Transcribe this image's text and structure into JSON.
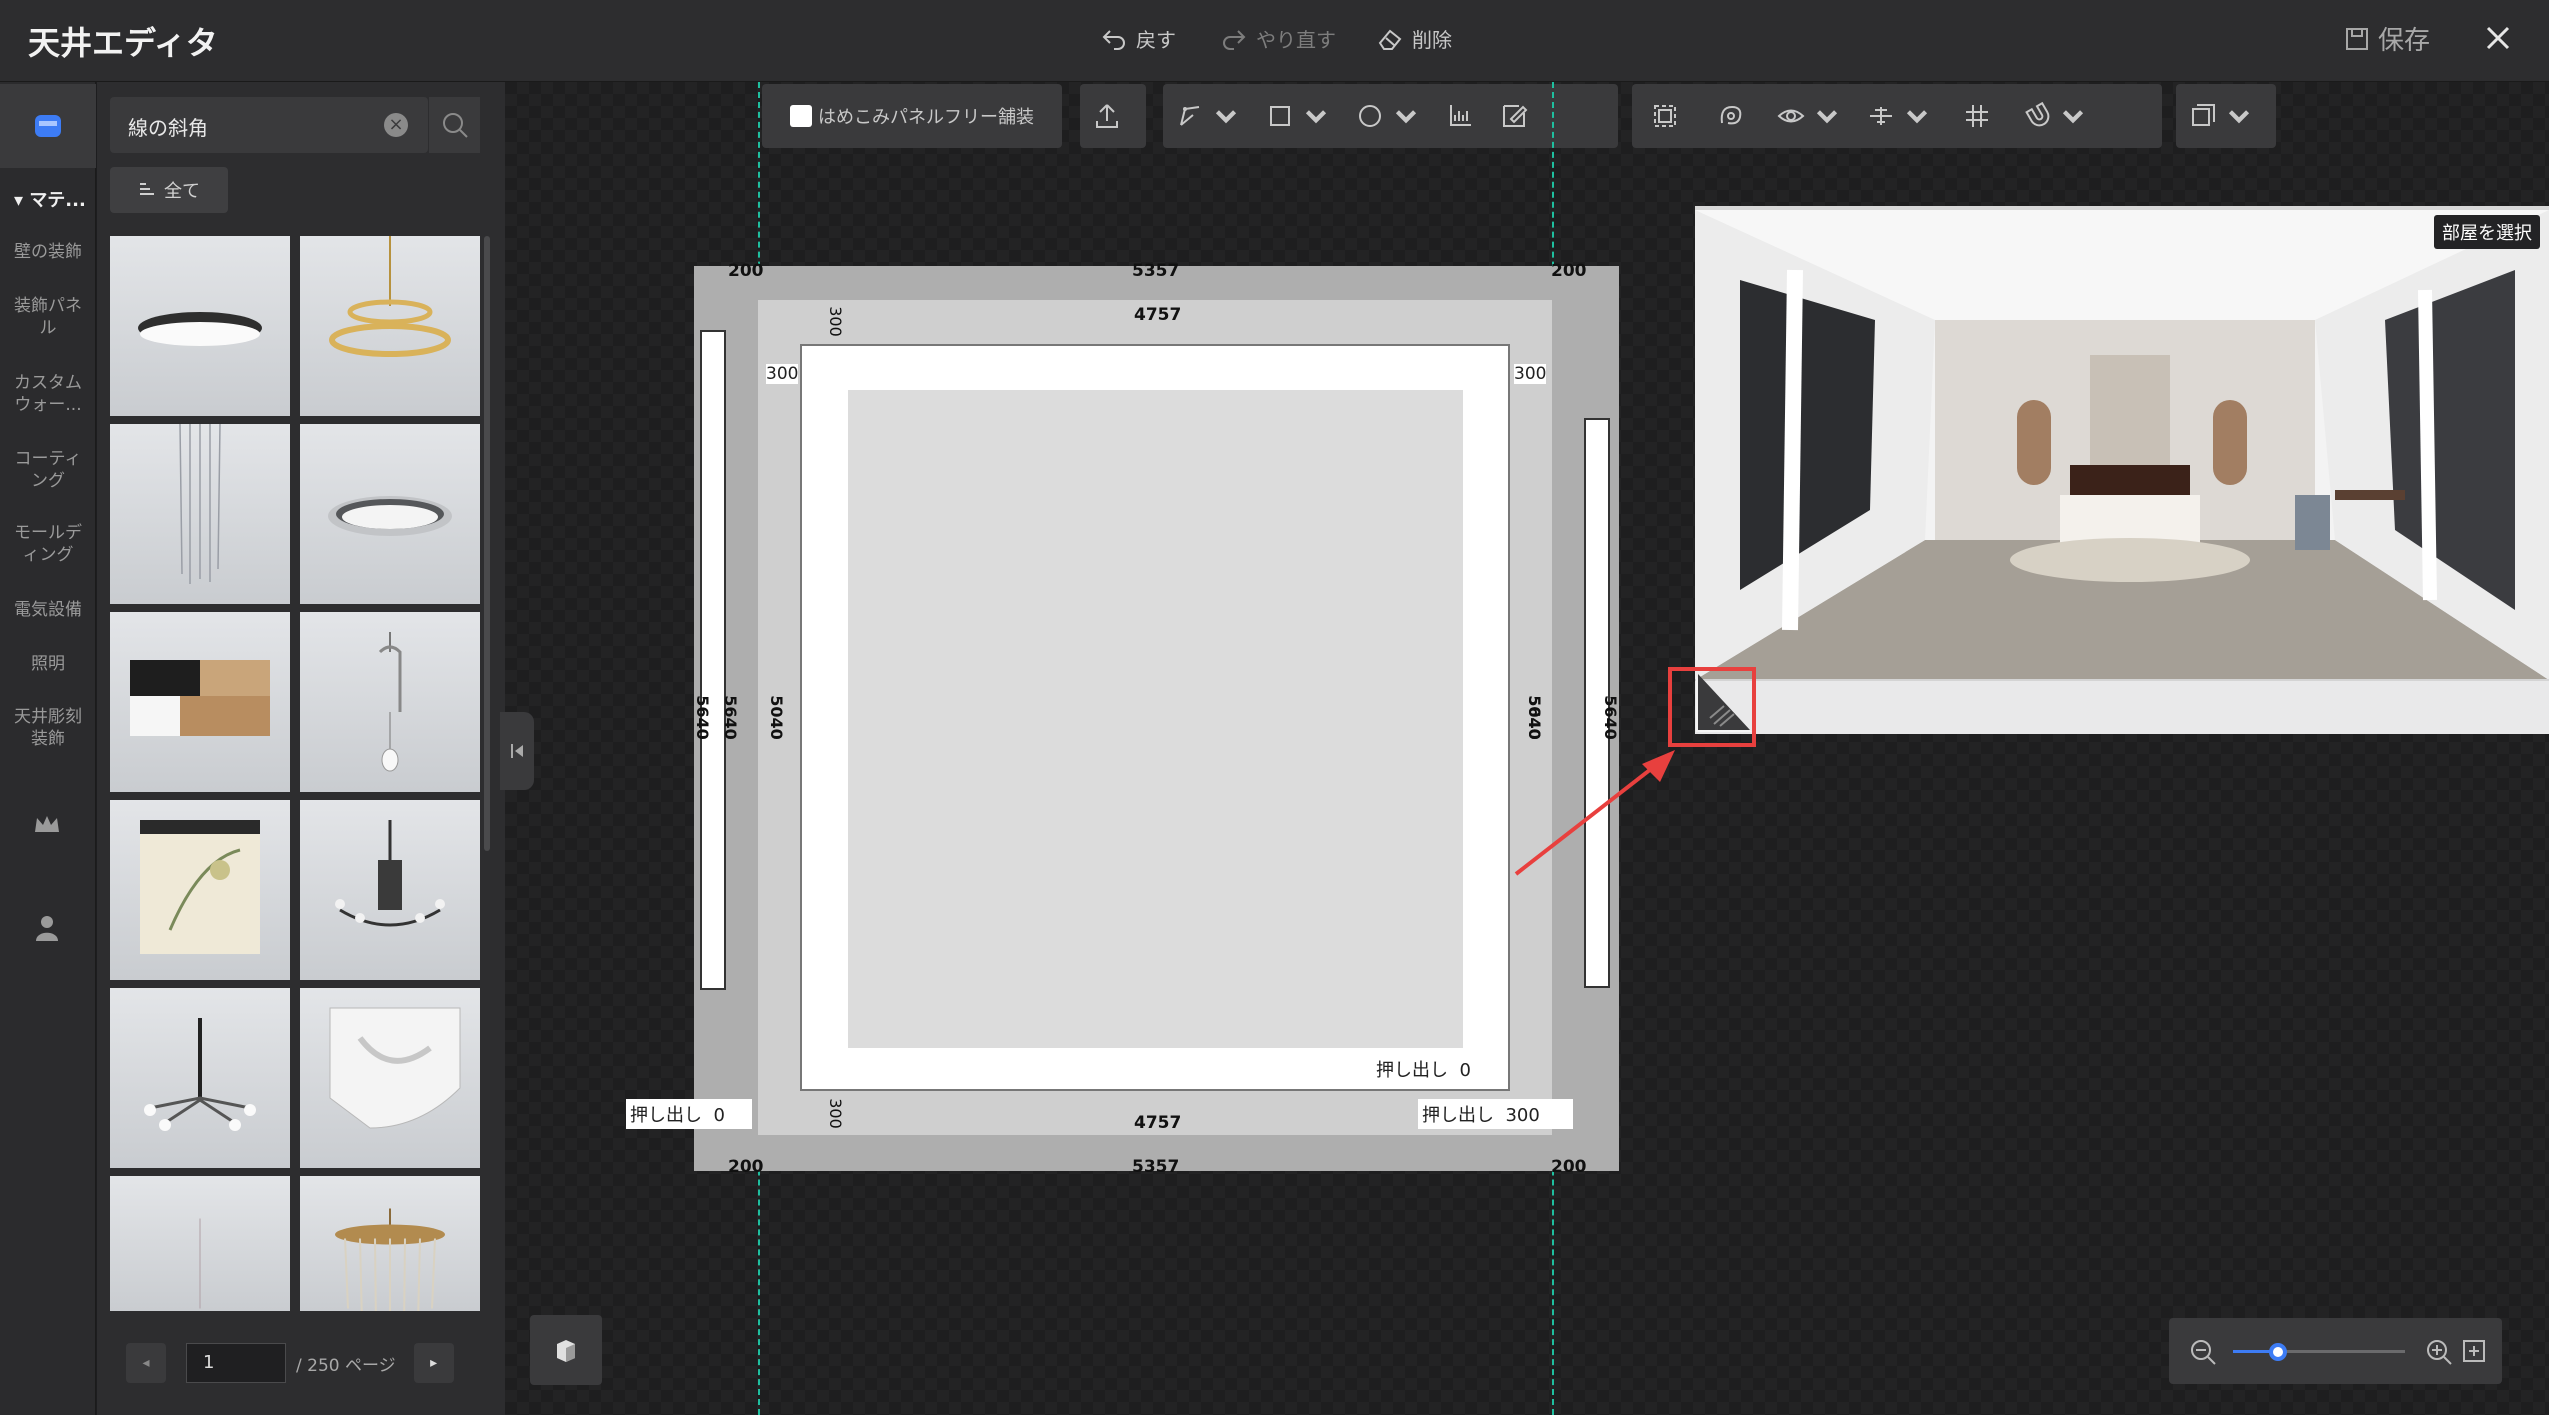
{
  "titlebar": {
    "title": "天井エディタ",
    "undo": "戻す",
    "redo": "やり直す",
    "delete": "削除",
    "save": "保存"
  },
  "rail": {
    "categories": [
      "マテ...",
      "壁の装飾",
      "装飾パネル",
      "カスタムウォー...",
      "コーティング",
      "モールディング",
      "電気設備",
      "照明",
      "天井彫刻装飾"
    ]
  },
  "catalog": {
    "search_value": "線の斜角",
    "filter_all": "全て",
    "items": [
      "ceiling-light-round-flat",
      "pendant-ring-chandelier",
      "crystal-strand-chandelier",
      "ceiling-light-round-ring",
      "ceiling-light-square-wood",
      "pendant-single-bulb",
      "lantern-ceiling-light-floral",
      "chandelier-classic-dark",
      "pendant-multi-arm",
      "ceiling-corbel-ornament",
      "crystal-chandelier-pink",
      "crystal-chandelier-gold"
    ],
    "pager": {
      "page": "1",
      "total": "/ 250 ページ"
    }
  },
  "toolbar": {
    "pave_label": "はめこみパネルフリー舗装"
  },
  "plan": {
    "dims": {
      "outer_width": "5357",
      "inner_width": "4757",
      "left_margin": "200",
      "right_margin": "200",
      "offset_300": "300",
      "height_outer": "5640",
      "height_inner": "5040"
    },
    "extrude_label": "押し出し",
    "extrude_inner": "0",
    "extrude_left": "0",
    "extrude_right": "300"
  },
  "preview": {
    "room_select": "部屋を選択"
  },
  "zoom": {
    "level": 0.26
  },
  "colors": {
    "accent": "#3d7cf5",
    "guide": "#1fbf9f",
    "highlight": "#e8403e"
  }
}
